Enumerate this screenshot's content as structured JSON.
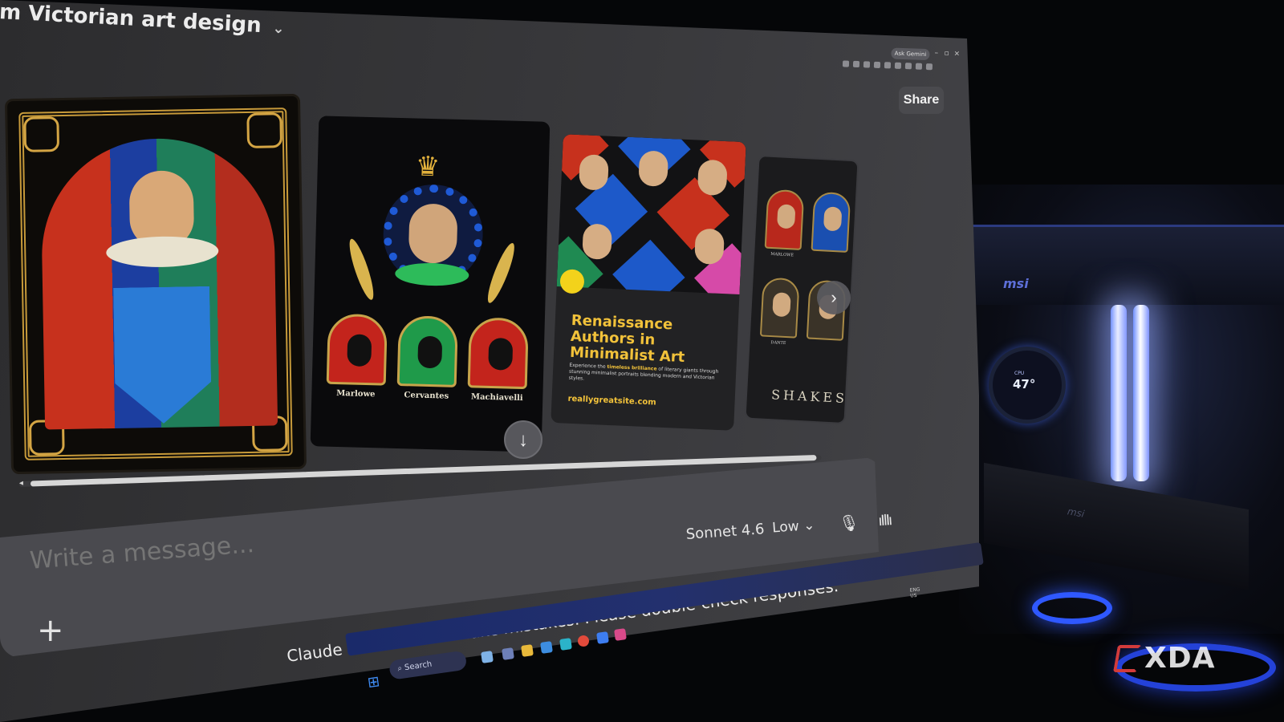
{
  "conversation": {
    "title": "m Victorian art design",
    "share_label": "Share"
  },
  "browser": {
    "ask_label": "Ask Gemini"
  },
  "gallery": {
    "card2_labels": [
      "Marlowe",
      "Cervantes",
      "Machiavelli"
    ],
    "card3": {
      "title": "Renaissance Authors in Minimalist Art",
      "description_prefix": "Experience the ",
      "description_bold": "timeless brilliance",
      "description_suffix": " of literary giants through stunning minimalist portraits blending modern and Victorian styles.",
      "url": "reallygreatsite.com"
    },
    "card4": {
      "labels": [
        "MARLOWE",
        "DANTE"
      ],
      "title": "SHAKESP"
    }
  },
  "composer": {
    "placeholder": "Write a message...",
    "model": "Sonnet 4.6",
    "effort": "Low"
  },
  "footer": {
    "disclaimer": "Claude is AI and can make mistakes. Please double-check responses."
  },
  "taskbar": {
    "search_label": "Search",
    "tray_lang": "ENG",
    "tray_region": "US"
  },
  "hardware": {
    "pump_label": "CPU",
    "pump_temp": "47°"
  },
  "watermark": {
    "text": "XDA"
  },
  "colors": {
    "accent_gold": "#f2c23a",
    "screen_bg": "#38383b",
    "composer_bg": "#4a4a4f",
    "xda_red": "#d23b3b"
  },
  "icons": {
    "title_chevron": "chevron-down-icon",
    "next": "chevron-right-icon",
    "scroll_down": "arrow-down-icon",
    "attach": "plus-icon",
    "mic": "microphone-icon",
    "voice": "waveform-icon"
  }
}
